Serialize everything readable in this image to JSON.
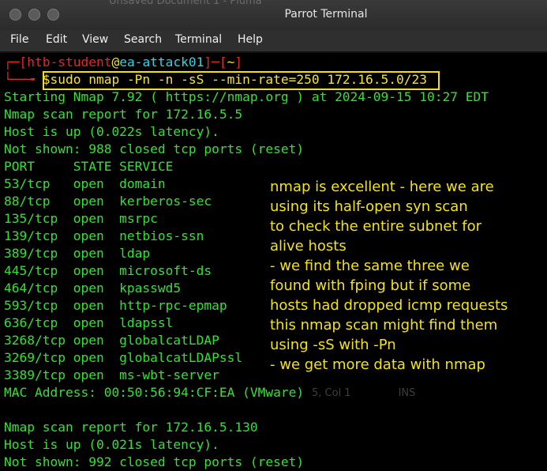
{
  "window": {
    "title": "Parrot Terminal",
    "background_title": "Unsaved Document 1 - Pluma",
    "buttons": [
      "close",
      "minimize",
      "maximize"
    ]
  },
  "menu": [
    "File",
    "Edit",
    "View",
    "Search",
    "Terminal",
    "Help"
  ],
  "prompt": {
    "corner_top": "┌─[",
    "user": "htb-student",
    "at": "@",
    "host": "ea-attack01",
    "sep": "]─[",
    "dir": "~",
    "close": "]",
    "corner_bottom": "└──╼ ",
    "dollar": "$",
    "command": "sudo nmap -Pn -n -sS --min-rate=250 172.16.5.0/23"
  },
  "output": [
    "Starting Nmap 7.92 ( https://nmap.org ) at 2024-09-15 10:27 EDT",
    "Nmap scan report for 172.16.5.5",
    "Host is up (0.022s latency).",
    "Not shown: 988 closed tcp ports (reset)",
    "PORT     STATE SERVICE",
    "53/tcp   open  domain",
    "88/tcp   open  kerberos-sec",
    "135/tcp  open  msrpc",
    "139/tcp  open  netbios-ssn",
    "389/tcp  open  ldap",
    "445/tcp  open  microsoft-ds",
    "464/tcp  open  kpasswd5",
    "593/tcp  open  http-rpc-epmap",
    "636/tcp  open  ldapssl",
    "3268/tcp open  globalcatLDAP",
    "3269/tcp open  globalcatLDAPssl",
    "3389/tcp open  ms-wbt-server",
    "MAC Address: 00:50:56:94:CF:EA (VMware)",
    "",
    "Nmap scan report for 172.16.5.130",
    "Host is up (0.021s latency).",
    "Not shown: 992 closed tcp ports (reset)"
  ],
  "annotation": [
    "nmap is excellent - here we are",
    "using its half-open syn scan",
    "to check the entire subnet for",
    "alive hosts",
    "- we find the same three we",
    "found with fping but if some",
    "hosts had dropped icmp requests",
    "this nmap scan might find them",
    "using -sS with -Pn",
    "- we get more data with nmap"
  ],
  "background_status": [
    "5, Col 1",
    "INS"
  ],
  "colors": {
    "terminal_green": "#35e035",
    "prompt_red": "#e02828",
    "prompt_cyan": "#2fd3e8",
    "highlight_yellow": "#f2e20e",
    "titlebar": "#2b2b2b"
  }
}
